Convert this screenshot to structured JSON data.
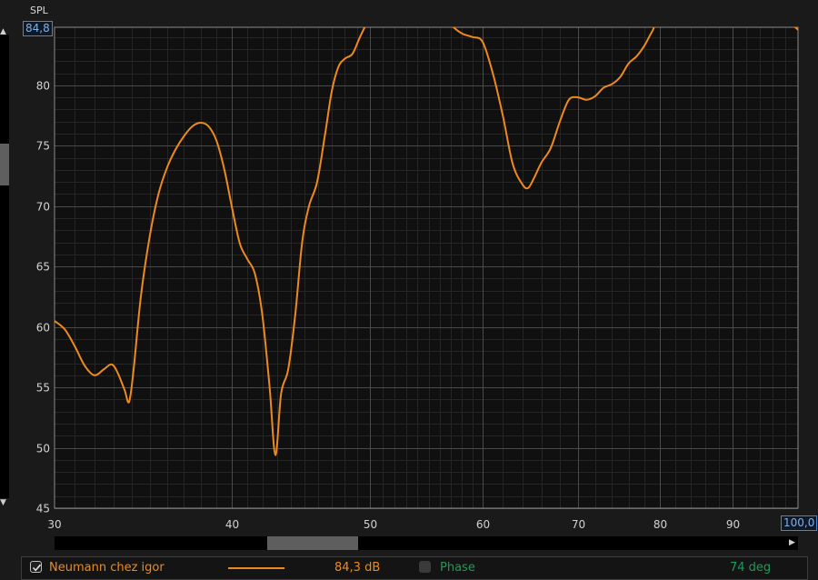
{
  "chart_data": {
    "type": "line",
    "ylabel": "SPL",
    "xlim": [
      30,
      100
    ],
    "ylim": [
      45,
      84.8
    ],
    "x_range_max_label": "100,0",
    "y_range_max_label": "84,8",
    "x_scale": "log",
    "grid": true,
    "y_ticks": [
      "80",
      "75",
      "70",
      "65",
      "60",
      "55",
      "50",
      "45"
    ],
    "x_ticks": [
      "30",
      "40",
      "50",
      "60",
      "70",
      "80",
      "90"
    ],
    "series": [
      {
        "name": "Neumann chez igor",
        "color": "#ee8a1c",
        "points": [
          [
            30.0,
            60.5
          ],
          [
            30.5,
            59.8
          ],
          [
            31.0,
            58.4
          ],
          [
            31.5,
            56.8
          ],
          [
            32.0,
            56.0
          ],
          [
            32.5,
            56.5
          ],
          [
            32.9,
            56.9
          ],
          [
            33.2,
            56.3
          ],
          [
            33.6,
            54.8
          ],
          [
            33.85,
            53.8
          ],
          [
            34.1,
            56.5
          ],
          [
            34.5,
            62.5
          ],
          [
            35.0,
            67.5
          ],
          [
            35.5,
            71.0
          ],
          [
            36.0,
            73.2
          ],
          [
            36.5,
            74.7
          ],
          [
            37.0,
            75.8
          ],
          [
            37.5,
            76.6
          ],
          [
            38.0,
            76.9
          ],
          [
            38.5,
            76.6
          ],
          [
            39.0,
            75.4
          ],
          [
            39.5,
            73.0
          ],
          [
            40.0,
            69.8
          ],
          [
            40.5,
            66.9
          ],
          [
            41.0,
            65.6
          ],
          [
            41.5,
            64.4
          ],
          [
            42.0,
            61.0
          ],
          [
            42.5,
            55.0
          ],
          [
            42.9,
            49.4
          ],
          [
            43.3,
            54.5
          ],
          [
            43.8,
            56.5
          ],
          [
            44.3,
            61.0
          ],
          [
            44.8,
            67.0
          ],
          [
            45.3,
            70.0
          ],
          [
            45.9,
            72.0
          ],
          [
            46.5,
            76.0
          ],
          [
            47.0,
            79.5
          ],
          [
            47.5,
            81.5
          ],
          [
            48.0,
            82.2
          ],
          [
            48.6,
            82.6
          ],
          [
            49.2,
            84.0
          ],
          [
            49.8,
            85.2
          ],
          [
            50.5,
            86.0
          ],
          [
            53.0,
            87.0
          ],
          [
            56.0,
            86.0
          ],
          [
            57.0,
            85.0
          ],
          [
            58.0,
            84.3
          ],
          [
            59.0,
            84.0
          ],
          [
            60.0,
            83.6
          ],
          [
            61.0,
            81.0
          ],
          [
            62.0,
            77.5
          ],
          [
            63.0,
            73.5
          ],
          [
            64.0,
            71.8
          ],
          [
            64.6,
            71.5
          ],
          [
            65.2,
            72.3
          ],
          [
            66.0,
            73.6
          ],
          [
            67.0,
            74.8
          ],
          [
            68.0,
            77.0
          ],
          [
            69.0,
            78.8
          ],
          [
            70.0,
            79.0
          ],
          [
            71.0,
            78.8
          ],
          [
            72.0,
            79.1
          ],
          [
            73.0,
            79.8
          ],
          [
            74.0,
            80.1
          ],
          [
            75.0,
            80.7
          ],
          [
            76.0,
            81.8
          ],
          [
            77.0,
            82.4
          ],
          [
            78.0,
            83.3
          ],
          [
            79.0,
            84.5
          ],
          [
            80.0,
            85.4
          ],
          [
            85.0,
            87.0
          ],
          [
            95.0,
            86.5
          ],
          [
            100.0,
            84.6
          ]
        ]
      }
    ]
  },
  "legend": {
    "series_name": "Neumann chez igor",
    "series_checked": true,
    "series_value": "84,3 dB",
    "phase_label": "Phase",
    "phase_checked": false,
    "phase_value": "74 deg",
    "series_color": "#ee8a1c",
    "phase_color": "#1f9a57"
  },
  "scrollbars": {
    "left_up_icon": "triangle-up",
    "left_down_icon": "triangle-down",
    "bottom_left_icon": "triangle-left",
    "bottom_right_icon": "triangle-right"
  }
}
